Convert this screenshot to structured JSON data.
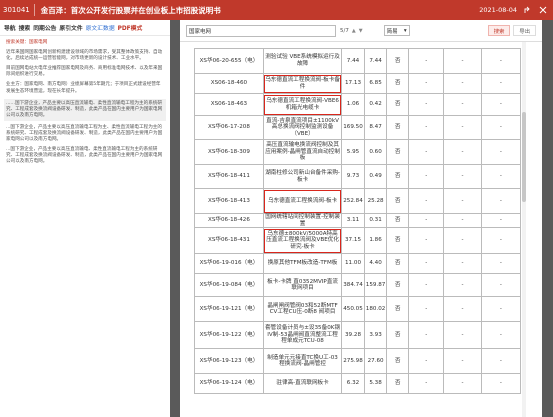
{
  "header": {
    "code": "301041",
    "title": "金百泽：首次公开发行股票并在创业板上市招股说明书",
    "date": "2021-08-04"
  },
  "nav": {
    "items": [
      "导航",
      "搜索",
      "同期公告",
      "原引文件",
      "原文汇数据",
      "PDF模式"
    ]
  },
  "left_paragraphs": [
    "搜索关键：国家电网",
    "近年来国网国家电网创新构建建设领域的市场需求，受其整体政策支持、自动化，后续达成统一运营智能网，对市场更新的设计技术、工业水平。",
    "目前国网电站大电年业推荐国家电网及商务、商用标准电网技术、以及年来国际间组织进行交易。",
    "业主方：国家电网、南方电网）业绩屏幕第5年期元；于项目正式建设经营年发展生态环境营运，现在长年提升。",
    "...…国下游企业，产品主要以高压直流输电、柔性直流输电工程为主的系统研究、工程成套及换流阀设备研发、制造，此类产品在国内主要用户为国家电网公司以及南方电网。",
    "...国下游企业，产品主要以高压直流输电工程为主、柔性直流输电工程为主的系统研究、工程成套及换流阀设备研发、制造，此类产品在国内主要用户为国家电网公司以及南方电网。",
    "...国下游企业，产品主要以高压直流输电、柔性直流输电工程为主的系统研究、工程成套及换流阀设备研发、制造，此类产品在国内主要用户为国家电网公司以及南方电网。"
  ],
  "toolbar": {
    "search_value": "国家电网",
    "page_indicator": "5/7",
    "select_value": "简易",
    "btn_search": "搜索",
    "btn_export": "导出"
  },
  "rows": [
    {
      "id": "XS华06-20-655（电）",
      "name": "测验试验 VBE系统模拟运行及故障",
      "qty": "7.44",
      "price": "7.44",
      "no": "否",
      "d1": "-",
      "d2": "-",
      "d3": "-",
      "hl": false
    },
    {
      "id": "XS06-18-460",
      "name": "乌东德直流工程换流阀-板卡备件",
      "qty": "17.13",
      "price": "6.85",
      "no": "否",
      "d1": "-",
      "d2": "-",
      "d3": "-",
      "hl": true
    },
    {
      "id": "XS06-18-463",
      "name": "乌东德直流工程换流阀-VBE6机箱光电缆卡",
      "qty": "1.06",
      "price": "0.42",
      "no": "否",
      "d1": "-",
      "d2": "-",
      "d3": "-",
      "hl": true
    },
    {
      "id": "XS华06-17-208",
      "name": "直流-吉泉直流项目±1100kV高总换流阀控制监测设备（VBE）",
      "qty": "169.50",
      "price": "8.47",
      "no": "否",
      "d1": "-",
      "d2": "-",
      "d3": "-",
      "hl": false
    },
    {
      "id": "XS华06-18-309",
      "name": "高压直流输电换流阀控制及其应用案例-晶闸管直流自动控制板",
      "qty": "5.95",
      "price": "0.60",
      "no": "否",
      "d1": "-",
      "d2": "-",
      "d3": "-",
      "hl": false
    },
    {
      "id": "XS华06-18-411",
      "name": "湖南柱修公司新山台备件采购-板卡",
      "qty": "9.73",
      "price": "0.49",
      "no": "否",
      "d1": "-",
      "d2": "-",
      "d3": "-",
      "hl": false
    },
    {
      "id": "XS华06-18-413",
      "name": "乌东德直流工程换流阀-板卡",
      "qty": "252.84",
      "price": "25.28",
      "no": "否",
      "d1": "-",
      "d2": "-",
      "d3": "-",
      "hl": true
    },
    {
      "id": "XS华06-18-426",
      "name": "国网统辖站间控制装置-控制装置",
      "qty": "3.11",
      "price": "0.31",
      "no": "否",
      "d1": "-",
      "d2": "-",
      "d3": "-",
      "hl": false
    },
    {
      "id": "XS华06-18-431",
      "name": "乌东德±800kV/5000A特高压直流工程换流阀及VBE优化研究-板卡",
      "qty": "37.15",
      "price": "1.86",
      "no": "否",
      "d1": "-",
      "d2": "-",
      "d3": "-",
      "hl": true
    },
    {
      "id": "XS华06-19-016（电）",
      "name": "换原其他TFM板改造-TFM板",
      "qty": "11.00",
      "price": "4.40",
      "no": "否",
      "d1": "-",
      "d2": "-",
      "d3": "-",
      "hl": false
    },
    {
      "id": "XS华06-19-084（电）",
      "name": "板卡-卡牌 直0352MVIP直流联网项目",
      "qty": "384.74",
      "price": "159.87",
      "no": "否",
      "d1": "-",
      "d2": "-",
      "d3": "-",
      "hl": false
    },
    {
      "id": "XS华06-19-121（电）",
      "name": "晶闸闸阀管阀03和52断MTF CV工程CU压-0断8 阀项目",
      "qty": "450.05",
      "price": "180.02",
      "no": "否",
      "d1": "-",
      "d2": "-",
      "d3": "-",
      "hl": false
    },
    {
      "id": "XS华06-19-122（电）",
      "name": "套管设备计员与±设35备0K钢IV制-53晶闸阀直流整流工程程单成元TCU-08",
      "qty": "39.28",
      "price": "3.93",
      "no": "否",
      "d1": "-",
      "d2": "-",
      "d3": "-",
      "hl": false
    },
    {
      "id": "XS华06-19-123（电）",
      "name": "制造单元元接直TC换U工-03程换流阀-晶闸管控",
      "qty": "275.98",
      "price": "27.60",
      "no": "否",
      "d1": "-",
      "d2": "-",
      "d3": "-",
      "hl": false
    },
    {
      "id": "XS华06-19-124（电）",
      "name": "驻律高-直流联网板卡",
      "qty": "6.32",
      "price": "5.38",
      "no": "否",
      "d1": "-",
      "d2": "-",
      "d3": "-",
      "hl": false
    }
  ]
}
